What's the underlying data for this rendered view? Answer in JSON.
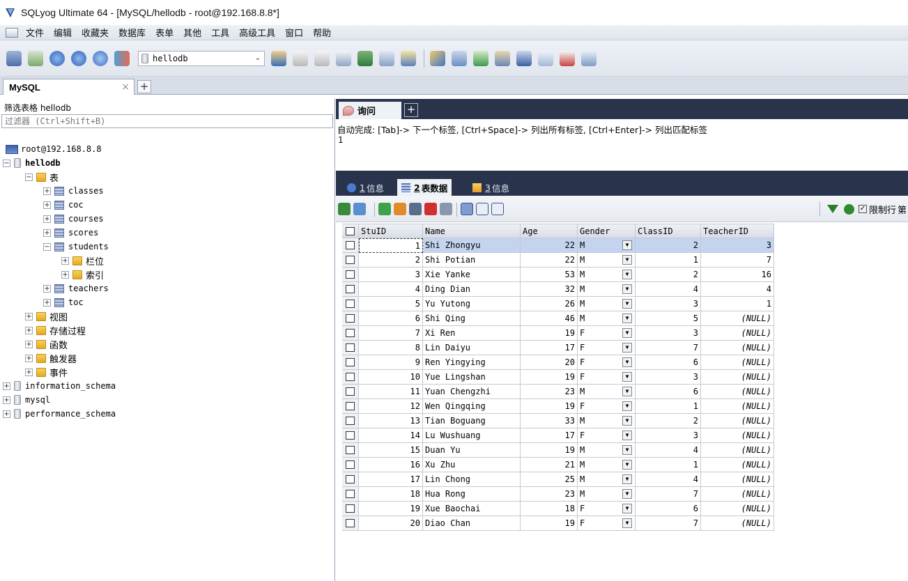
{
  "window": {
    "title": "SQLyog Ultimate 64 - [MySQL/hellodb - root@192.168.8.8*]"
  },
  "menu": [
    "文件",
    "编辑",
    "收藏夹",
    "数据库",
    "表单",
    "其他",
    "工具",
    "高级工具",
    "窗口",
    "帮助"
  ],
  "toolbar": {
    "database_select": "hellodb"
  },
  "connection_tab": {
    "label": "MySQL",
    "close": "×",
    "add": "+"
  },
  "left_panel": {
    "filter_label": "筛选表格 hellodb",
    "filter_placeholder": "过滤器 (Ctrl+Shift+B)",
    "tree": {
      "server": "root@192.168.8.8",
      "database": "hellodb",
      "tables_folder": "表",
      "tables": [
        "classes",
        "coc",
        "courses",
        "scores",
        "students",
        "teachers",
        "toc"
      ],
      "students_children": [
        "栏位",
        "索引"
      ],
      "folders": [
        "视图",
        "存储过程",
        "函数",
        "触发器",
        "事件"
      ],
      "other_databases": [
        "information_schema",
        "mysql",
        "performance_schema"
      ]
    }
  },
  "query": {
    "tab_label": "询问",
    "add": "+",
    "autocomplete_hint": "自动完成: [Tab]-> 下一个标签, [Ctrl+Space]-> 列出所有标签, [Ctrl+Enter]-> 列出匹配标签",
    "editor_line": "1"
  },
  "result_tabs": [
    {
      "num": "1",
      "label": "信息"
    },
    {
      "num": "2",
      "label": "表数据"
    },
    {
      "num": "3",
      "label": "信息"
    }
  ],
  "grid_toolbar": {
    "limit_label": "限制行",
    "extra": "第",
    "limit_checked": "✓"
  },
  "table": {
    "columns": [
      "StuID",
      "Name",
      "Age",
      "Gender",
      "ClassID",
      "TeacherID"
    ],
    "rows": [
      [
        "1",
        "Shi Zhongyu",
        "22",
        "M",
        "2",
        "3"
      ],
      [
        "2",
        "Shi Potian",
        "22",
        "M",
        "1",
        "7"
      ],
      [
        "3",
        "Xie Yanke",
        "53",
        "M",
        "2",
        "16"
      ],
      [
        "4",
        "Ding Dian",
        "32",
        "M",
        "4",
        "4"
      ],
      [
        "5",
        "Yu Yutong",
        "26",
        "M",
        "3",
        "1"
      ],
      [
        "6",
        "Shi Qing",
        "46",
        "M",
        "5",
        "(NULL)"
      ],
      [
        "7",
        "Xi Ren",
        "19",
        "F",
        "3",
        "(NULL)"
      ],
      [
        "8",
        "Lin Daiyu",
        "17",
        "F",
        "7",
        "(NULL)"
      ],
      [
        "9",
        "Ren Yingying",
        "20",
        "F",
        "6",
        "(NULL)"
      ],
      [
        "10",
        "Yue Lingshan",
        "19",
        "F",
        "3",
        "(NULL)"
      ],
      [
        "11",
        "Yuan Chengzhi",
        "23",
        "M",
        "6",
        "(NULL)"
      ],
      [
        "12",
        "Wen Qingqing",
        "19",
        "F",
        "1",
        "(NULL)"
      ],
      [
        "13",
        "Tian Boguang",
        "33",
        "M",
        "2",
        "(NULL)"
      ],
      [
        "14",
        "Lu Wushuang",
        "17",
        "F",
        "3",
        "(NULL)"
      ],
      [
        "15",
        "Duan Yu",
        "19",
        "M",
        "4",
        "(NULL)"
      ],
      [
        "16",
        "Xu Zhu",
        "21",
        "M",
        "1",
        "(NULL)"
      ],
      [
        "17",
        "Lin Chong",
        "25",
        "M",
        "4",
        "(NULL)"
      ],
      [
        "18",
        "Hua Rong",
        "23",
        "M",
        "7",
        "(NULL)"
      ],
      [
        "19",
        "Xue Baochai",
        "18",
        "F",
        "6",
        "(NULL)"
      ],
      [
        "20",
        "Diao Chan",
        "19",
        "F",
        "7",
        "(NULL)"
      ]
    ]
  },
  "colors": {
    "dark_tabbar": "#29334c",
    "selection": "#c4d4ee"
  }
}
